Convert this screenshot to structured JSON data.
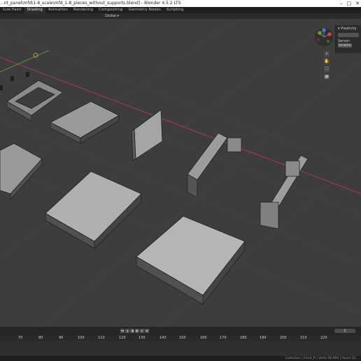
{
  "window": {
    "title": "...nt_panel\\mfd\\1-8_scale\\mfd_1-8_pieces_without_supports.blend] - Blender 4.5.2 LTS"
  },
  "menubar": {
    "workspaces": [
      "ture Paint",
      "Shading",
      "Animation",
      "Rendering",
      "Compositing",
      "Geometry Nodes",
      "Scripting"
    ],
    "active": "Shading"
  },
  "viewport_header": {
    "orientation": "Global"
  },
  "npanel": {
    "title": "Plasticity",
    "server_label": "Server:",
    "server_value": "localho"
  },
  "timeline": {
    "current_frame": "1",
    "ruler_ticks": [
      "70",
      "80",
      "90",
      "100",
      "110",
      "120",
      "130",
      "140",
      "150",
      "160",
      "170",
      "180",
      "190",
      "200",
      "210",
      "220"
    ]
  },
  "statusbar": {
    "text": "Collection | Front_R | Verts:36,994 | Faces:32,..."
  },
  "colors": {
    "axis_x": "#d33f4f",
    "axis_y": "#6f9b2a",
    "axis_z": "#4a78c9",
    "viewport_bg": "#3d3d3d"
  }
}
